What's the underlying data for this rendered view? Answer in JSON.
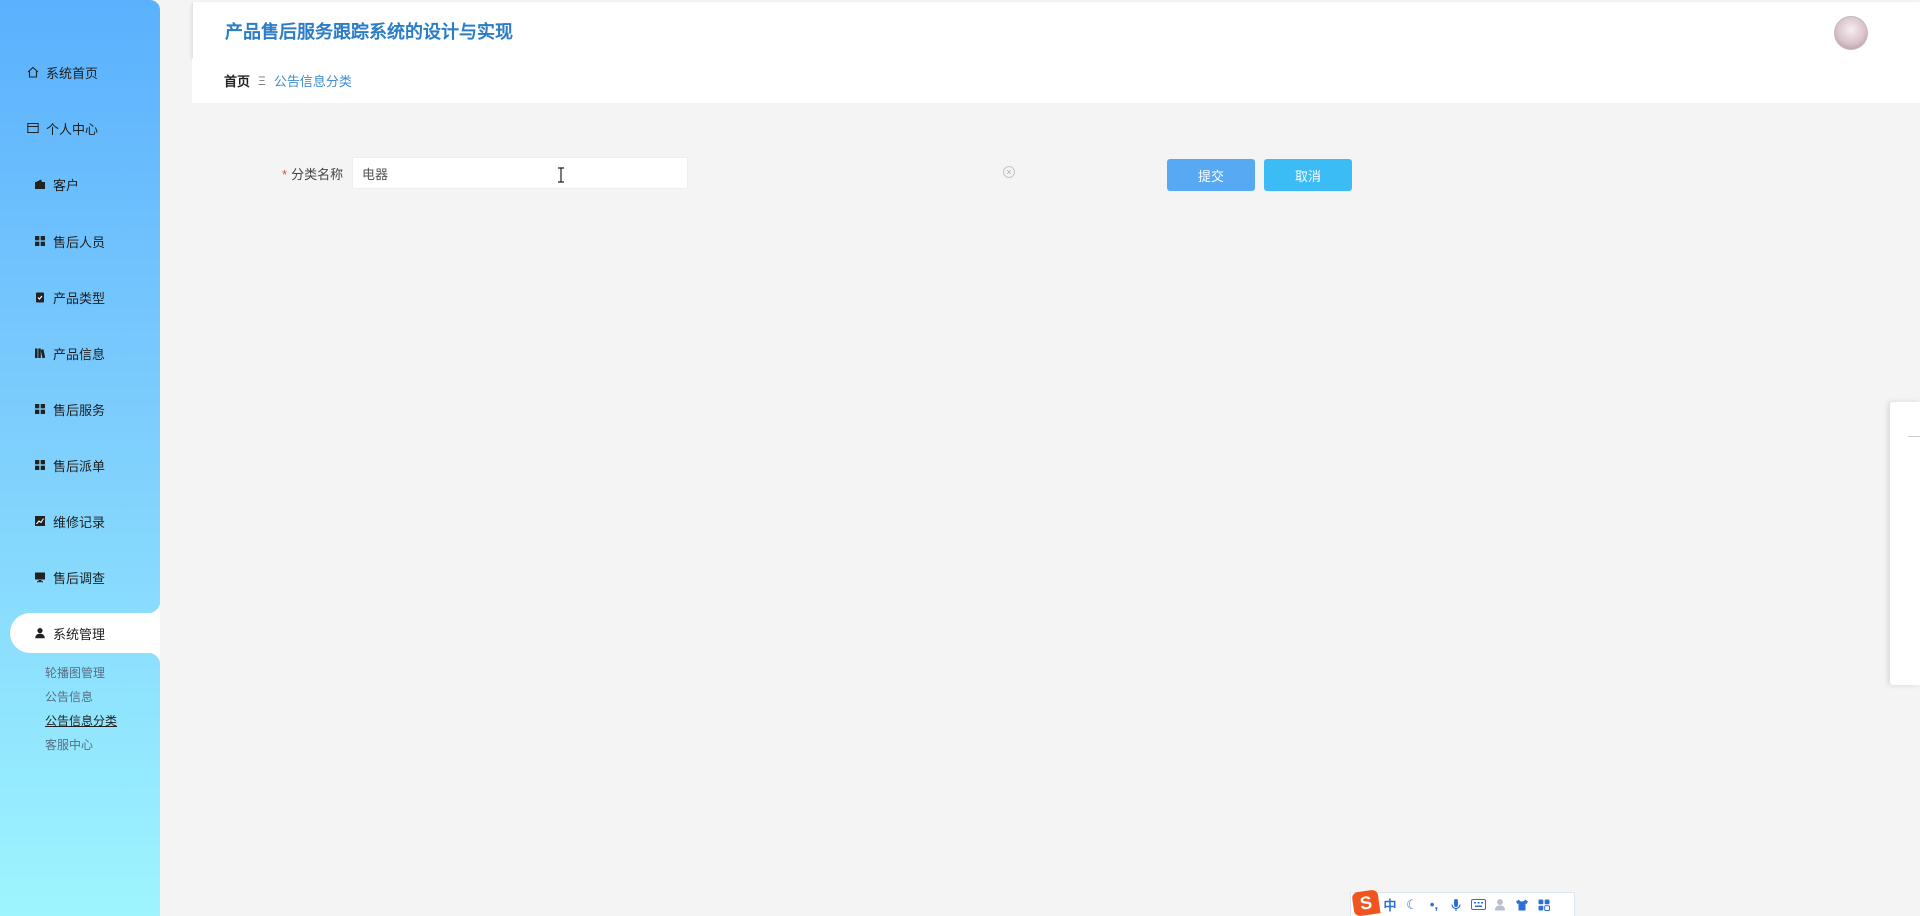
{
  "app": {
    "title": "产品售后服务跟踪系统的设计与实现"
  },
  "sidebar": {
    "items": [
      {
        "label": "系统首页",
        "icon": "home-icon"
      },
      {
        "label": "个人中心",
        "icon": "id-card-icon"
      },
      {
        "label": "客户",
        "icon": "wallet-icon"
      },
      {
        "label": "售后人员",
        "icon": "grid-icon"
      },
      {
        "label": "产品类型",
        "icon": "clipboard-check-icon"
      },
      {
        "label": "产品信息",
        "icon": "books-icon"
      },
      {
        "label": "售后服务",
        "icon": "grid-icon"
      },
      {
        "label": "售后派单",
        "icon": "grid-icon"
      },
      {
        "label": "维修记录",
        "icon": "chart-area-icon"
      },
      {
        "label": "售后调查",
        "icon": "monitor-icon"
      },
      {
        "label": "系统管理",
        "icon": "user-icon"
      }
    ],
    "active_index": 10,
    "sub_items": [
      {
        "label": "轮播图管理"
      },
      {
        "label": "公告信息"
      },
      {
        "label": "公告信息分类"
      },
      {
        "label": "客服中心"
      }
    ],
    "current_sub_index": 2
  },
  "breadcrumb": {
    "home": "首页",
    "separator": "Ξ",
    "current": "公告信息分类"
  },
  "form": {
    "required_mark": "*",
    "field_label": "分类名称",
    "field_value": "电器",
    "clear_icon": "circle-x-icon",
    "submit_label": "提交",
    "cancel_label": "取消"
  },
  "ime": {
    "logo": "S",
    "items": [
      "中",
      "☾",
      "•,",
      "mic-icon",
      "keyboard-icon",
      "user-icon",
      "shirt-icon",
      "apps-icon"
    ]
  },
  "colors": {
    "sidebar_top": "#5ab1fd",
    "sidebar_bottom": "#9ef5fe",
    "title": "#2a7dc6",
    "submit": "#57a9f4",
    "cancel": "#3bbcf5",
    "required": "#e04444"
  }
}
